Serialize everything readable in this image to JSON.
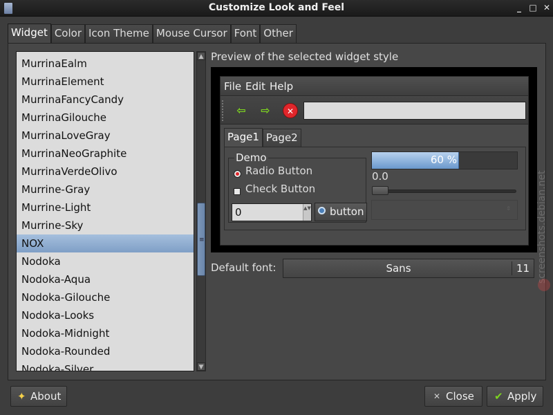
{
  "window": {
    "title": "Customize Look and Feel",
    "minimize_glyph": "_",
    "maximize_glyph": "□",
    "close_glyph": "✕"
  },
  "tabs": [
    "Widget",
    "Color",
    "Icon Theme",
    "Mouse Cursor",
    "Font",
    "Other"
  ],
  "theme_list": {
    "items": [
      "MurrinaEalm",
      "MurrinaElement",
      "MurrinaFancyCandy",
      "MurrinaGilouche",
      "MurrinaLoveGray",
      "MurrinaNeoGraphite",
      "MurrinaVerdeOlivo",
      "Murrine-Gray",
      "Murrine-Light",
      "Murrine-Sky",
      "NOX",
      "Nodoka",
      "Nodoka-Aqua",
      "Nodoka-Gilouche",
      "Nodoka-Looks",
      "Nodoka-Midnight",
      "Nodoka-Rounded",
      "Nodoka-Silver"
    ],
    "selected": "NOX",
    "scroll_up_glyph": "▲",
    "scroll_down_glyph": "▼",
    "scroll_grip_glyph": "≡"
  },
  "preview": {
    "label": "Preview of the selected widget style",
    "menu": [
      "File",
      "Edit",
      "Help"
    ],
    "toolbar_icons": [
      "back-arrow-icon",
      "forward-arrow-icon",
      "stop-icon"
    ],
    "back_glyph": "⇦",
    "forward_glyph": "⇨",
    "stop_glyph": "✕",
    "address_value": "",
    "tabs": [
      "Page1",
      "Page2"
    ],
    "demo_label": "Demo",
    "radio_label": "Radio Button",
    "radio_checked": true,
    "check_label": "Check Button",
    "check_checked": false,
    "spin_value": "0",
    "spin_arrows": "▲▼",
    "button_label": "button",
    "progress_text": "60 %",
    "progress_value": 0.6,
    "scale_value_text": "0.0",
    "scale_value": 0,
    "combo_arrow": "⇕"
  },
  "font": {
    "label": "Default font:",
    "name": "Sans",
    "size": "11"
  },
  "watermark": "screenshots.debian.net",
  "buttons": {
    "about": "About",
    "about_icon": "✦",
    "close": "Close",
    "close_icon": "✕",
    "apply": "Apply",
    "apply_icon": "✔"
  },
  "colors": {
    "background": "#3d3d3d",
    "selection": "#8eaad0",
    "progress": "#6a98cc",
    "accent_green": "#7dd321",
    "stop_red": "#e0262b"
  }
}
